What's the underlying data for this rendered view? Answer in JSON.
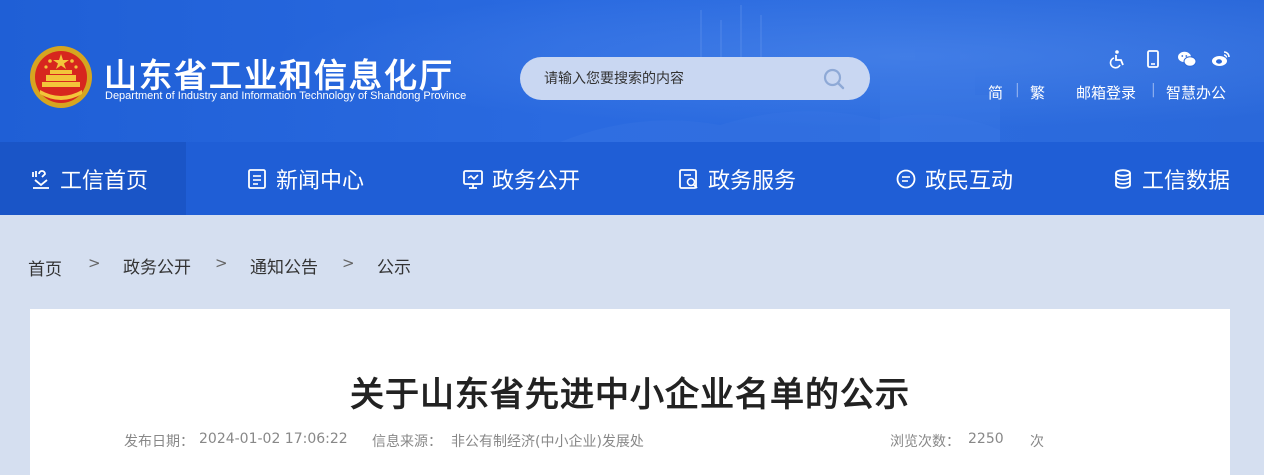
{
  "header": {
    "title": "山东省工业和信息化厅",
    "subtitle": "Department of Industry and Information Technology of Shandong Province",
    "search": {
      "placeholder": "请输入您要搜索的内容"
    },
    "tool_icons": [
      "accessibility-icon",
      "mobile-icon",
      "wechat-icon",
      "weibo-icon"
    ],
    "lang": {
      "simplified": "简",
      "traditional": "繁"
    },
    "links": {
      "mail_login": "邮箱登录",
      "smart_office": "智慧办公"
    }
  },
  "nav": {
    "items": [
      {
        "label": "工信首页",
        "icon": "home-icon",
        "active": true
      },
      {
        "label": "新闻中心",
        "icon": "news-icon"
      },
      {
        "label": "政务公开",
        "icon": "monitor-icon"
      },
      {
        "label": "政务服务",
        "icon": "service-icon"
      },
      {
        "label": "政民互动",
        "icon": "chat-icon"
      },
      {
        "label": "工信数据",
        "icon": "database-icon"
      }
    ]
  },
  "breadcrumb": {
    "items": [
      "首页",
      "政务公开",
      "通知公告",
      "公示"
    ],
    "separator": ">"
  },
  "article": {
    "title": "关于山东省先进中小企业名单的公示",
    "publish_label": "发布日期：",
    "publish_date": "2024-01-02 17:06:22",
    "source_label": "信息来源：",
    "source": "非公有制经济(中小企业)发展处",
    "views_label": "浏览次数：",
    "views": "2250",
    "views_unit": "次"
  },
  "colors": {
    "header_blue": "#2a68da",
    "nav_blue": "#1f5ed6",
    "page_bg": "#d5dff0",
    "search_bg": "#c9d7f2"
  }
}
